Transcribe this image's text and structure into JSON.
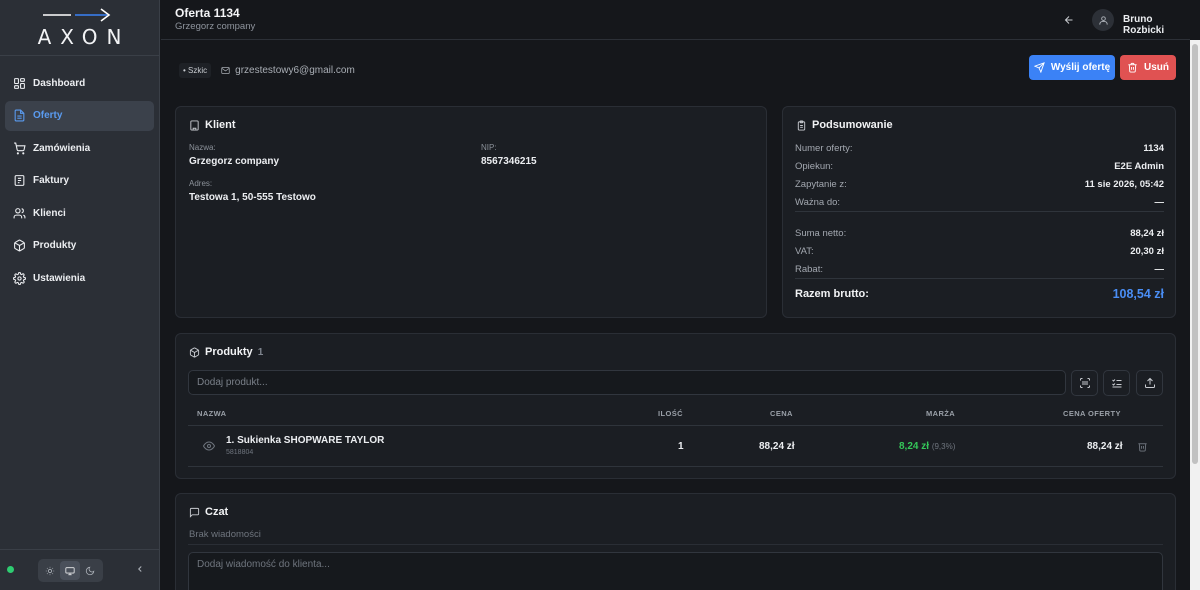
{
  "app": {
    "logo_text": "AXON"
  },
  "sidebar": {
    "items": [
      {
        "label": "Dashboard",
        "icon": "dashboard-icon"
      },
      {
        "label": "Oferty",
        "icon": "document-icon",
        "active": true
      },
      {
        "label": "Zamówienia",
        "icon": "cart-icon"
      },
      {
        "label": "Faktury",
        "icon": "invoice-icon"
      },
      {
        "label": "Klienci",
        "icon": "users-icon"
      },
      {
        "label": "Produkty",
        "icon": "package-icon"
      },
      {
        "label": "Ustawienia",
        "icon": "gear-icon"
      }
    ],
    "theme_options": [
      "light",
      "system",
      "dark"
    ],
    "theme_selected": "system",
    "status_color": "#2ecc71"
  },
  "header": {
    "title": "Oferta 1134",
    "subtitle": "Grzegorz company",
    "user_name": "Bruno Rozbicki"
  },
  "offer": {
    "status_badge": "• Szkic",
    "email": "grzestestowy6@gmail.com",
    "send_label": "Wyślij ofertę",
    "delete_label": "Usuń"
  },
  "client": {
    "title": "Klient",
    "name_label": "Nazwa:",
    "name": "Grzegorz company",
    "nip_label": "NIP:",
    "nip": "8567346215",
    "address_label": "Adres:",
    "address": "Testowa 1, 50-555 Testowo"
  },
  "summary": {
    "title": "Podsumowanie",
    "rows": [
      {
        "label": "Numer oferty:",
        "value": "1134"
      },
      {
        "label": "Opiekun:",
        "value": "E2E Admin"
      },
      {
        "label": "Zapytanie z:",
        "value": "11 sie 2026, 05:42"
      },
      {
        "label": "Ważna do:",
        "value": "—"
      },
      {
        "label": "Suma netto:",
        "value": "88,24 zł"
      },
      {
        "label": "VAT:",
        "value": "20,30 zł"
      },
      {
        "label": "Rabat:",
        "value": "—"
      }
    ],
    "total_label": "Razem brutto:",
    "total_value": "108,54 zł",
    "accent": "#4a8ef5"
  },
  "products": {
    "title": "Produkty",
    "count": "1",
    "add_placeholder": "Dodaj produkt...",
    "columns": [
      "NAZWA",
      "ILOŚĆ",
      "CENA",
      "MARŻA",
      "CENA OFERTY"
    ],
    "rows": [
      {
        "name": "1. Sukienka SHOPWARE TAYLOR",
        "sku": "5818804",
        "qty": "1",
        "price": "88,24 zł",
        "margin": "8,24 zł",
        "margin_pct": "(9,3%)",
        "offer_price": "88,24 zł"
      }
    ]
  },
  "chat": {
    "title": "Czat",
    "empty_text": "Brak wiadomości",
    "input_placeholder": "Dodaj wiadomość do klienta..."
  }
}
